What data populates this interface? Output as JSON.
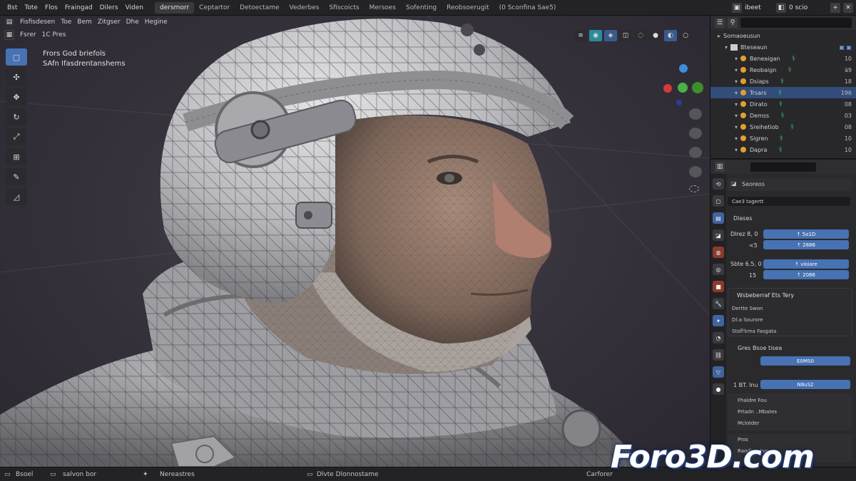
{
  "menu": [
    "Bst",
    "Tote",
    "Flos",
    "Fraingad",
    "Dilers",
    "Viden"
  ],
  "workspaces": [
    {
      "label": "dersmorr",
      "active": true
    },
    {
      "label": "Ceptartor",
      "active": false
    },
    {
      "label": "Detoectame",
      "active": false
    },
    {
      "label": "Vederbes",
      "active": false
    },
    {
      "label": "Sfiscoicts",
      "active": false
    },
    {
      "label": "Mersoes",
      "active": false
    },
    {
      "label": "Sofenting",
      "active": false
    },
    {
      "label": "Reobsoerugit",
      "active": false
    },
    {
      "label": "(0 Sconfina Sae5)",
      "active": false
    }
  ],
  "topright": {
    "scene_label": "ibeet",
    "layer_label": "0 scio"
  },
  "viewport": {
    "header_labels": [
      "Fsrer",
      "1C Pres"
    ],
    "menu_labels": [
      "Fisfisdesen",
      "Toe",
      "Bem",
      "Zitgser",
      "Dhe",
      "Hegine"
    ],
    "info_line1": "Frors God briefols",
    "info_line2": "SAfn Ifasdrentanshems"
  },
  "outliner": {
    "root": "Somaoeusun",
    "collection": "Bteseaun",
    "items": [
      {
        "name": "Beneaigan",
        "num": "10",
        "selected": false
      },
      {
        "name": "Reobaign",
        "num": "ä9",
        "selected": false
      },
      {
        "name": "Dsiaps",
        "num": "18",
        "selected": false
      },
      {
        "name": "Trsars",
        "num": "196",
        "selected": true
      },
      {
        "name": "Dirato",
        "num": "08",
        "selected": false
      },
      {
        "name": "Demss",
        "num": "03",
        "selected": false
      },
      {
        "name": "Sreihetiob",
        "num": "08",
        "selected": false
      },
      {
        "name": "Sigren",
        "num": "10",
        "selected": false
      },
      {
        "name": "Dapra",
        "num": "10",
        "selected": false
      }
    ]
  },
  "properties": {
    "object_name": "Seoreos",
    "data_label": "Cae3 tagertt",
    "section1_title": "Dlases",
    "row1_label": "Dlrez 8, 0",
    "row1_sub": "<5",
    "row1_field1": "↑ 5o1D",
    "row1_field2": "↑ 2886",
    "row2_label": "Sbte 6.5, 0",
    "row2_sub": "15",
    "row2_field1": "↑ vioiare",
    "row2_field2": "↑ 2086",
    "panel_title": "Wsbeberraf Ets Tery",
    "panel_items": [
      "Dertte Swon",
      "Dl:a Sourore",
      "Stofl'kma Fasgata"
    ],
    "section2_title": "Gres Bsoe tisea",
    "section2_field": "E0MS0",
    "section3_label": "1 BT. Inu",
    "section3_field": "N8uS2",
    "list_items": [
      "Fhaldre Fou",
      "Prtadn ..Mbates",
      "Mclotder"
    ],
    "list2_items": [
      "Pros",
      "Raodlaestver"
    ]
  },
  "statusbar": {
    "item1": "Bsoel",
    "item2": "salvon bor",
    "item3": "Nereastres",
    "item4": "Dlvte Dlonnostame",
    "item5": "Carforer"
  },
  "watermark": "Foro3D.com",
  "colors": {
    "accent": "#4772b3",
    "selection": "#334d7a",
    "object_dot": "#e0a030",
    "modifier_icon": "#39c46a"
  }
}
